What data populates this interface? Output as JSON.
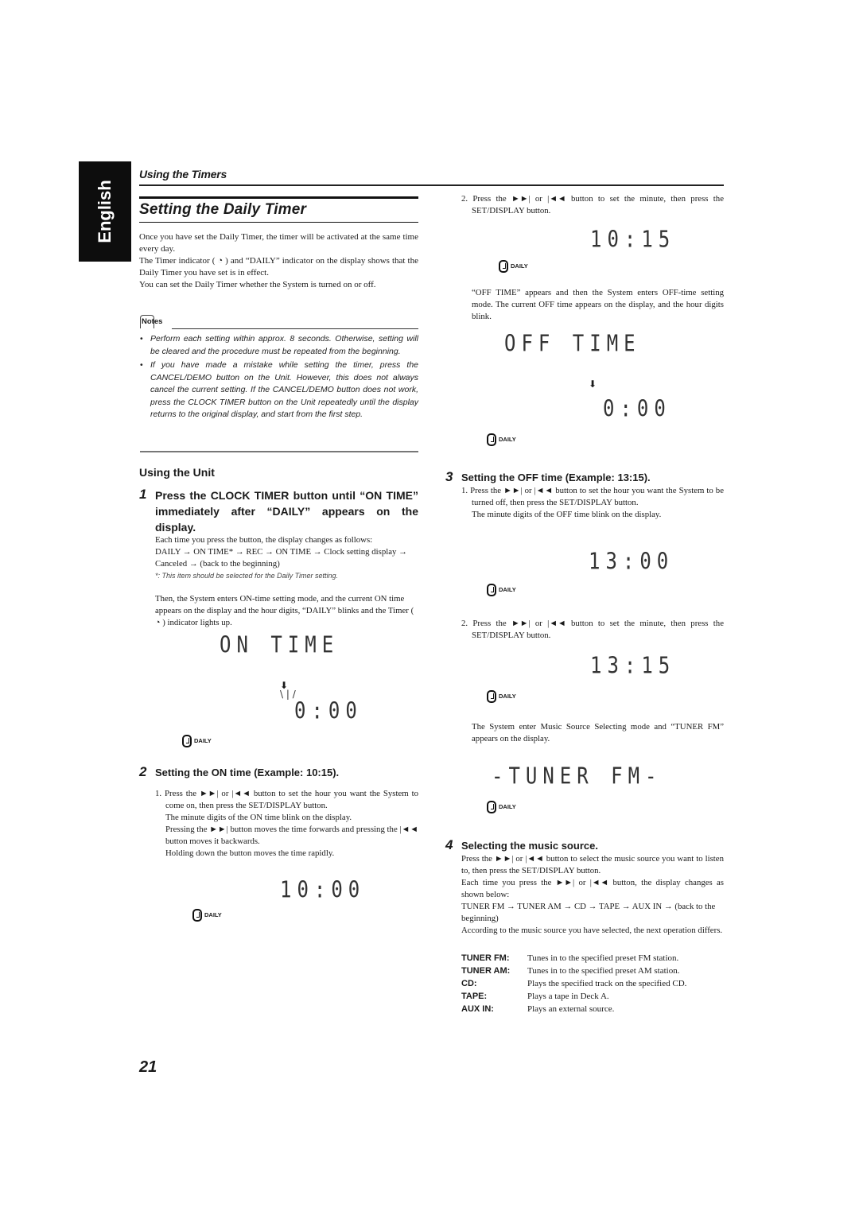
{
  "language_tab": "English",
  "section_header": "Using the Timers",
  "title": "Setting the Daily Timer",
  "intro": [
    "Once you have set the Daily Timer, the timer will be activated at the same time every day.",
    "The Timer indicator ( ◔ ) and “DAILY” indicator on the display shows that the Daily Timer you have set is in effect.",
    "You can set the Daily Timer whether the System is turned on or off."
  ],
  "notes": {
    "label": "Notes",
    "items": [
      "Perform each setting within approx. 8 seconds. Otherwise, setting will be cleared and the procedure must be repeated from the beginning.",
      "If you have made a mistake while setting the timer, press the CANCEL/DEMO button on the Unit. However, this does not always cancel the current setting. If the CANCEL/DEMO button does not work, press the CLOCK TIMER button on the Unit repeatedly until the display returns to the original display, and start from the first step."
    ]
  },
  "using_unit": "Using the Unit",
  "step1": {
    "num": "1",
    "heading": "Press the CLOCK TIMER button until “ON TIME” immediately after “DAILY” appears on the display.",
    "body": "Each time you press the button, the display changes as follows:",
    "sequence": "DAILY → ON TIME* → REC → ON TIME → Clock setting display → Canceled → (back to the beginning)",
    "footnote": "*: This item should be selected for the Daily Timer setting.",
    "after": "Then, the System enters ON-time setting mode, and the current ON time appears on the display and the hour digits, “DAILY” blinks and the Timer ( ◔ ) indicator lights up.",
    "lcd_text": "ON  TIME",
    "lcd_time": "0:00"
  },
  "step2": {
    "num": "2",
    "heading": "Setting the ON time (Example: 10:15).",
    "item1": "1. Press the ►►| or |◄◄ button to set the hour you want the System to come on, then press the SET/DISPLAY button.",
    "item1b": "The minute digits of the ON time blink on the display.",
    "item1c": "Pressing the ►►| button moves the time forwards and pressing the |◄◄ button moves it backwards.",
    "item1d": "Holding down the button moves the time rapidly.",
    "lcd_time1": "10:00",
    "item2": "2. Press the ►►| or |◄◄ button to set the minute, then press the SET/DISPLAY button.",
    "lcd_time2": "10:15",
    "after": "“OFF TIME” appears and then the System enters OFF-time setting mode. The current OFF time appears on the display, and the hour digits blink.",
    "lcd_text": "OFF  TIME",
    "lcd_time3": "0:00"
  },
  "step3": {
    "num": "3",
    "heading": "Setting the OFF time (Example: 13:15).",
    "item1": "1. Press the ►►| or |◄◄ button to set the hour you want the System to be turned off, then press the SET/DISPLAY button.",
    "item1b": "The minute digits of the OFF time blink on the display.",
    "lcd_time1": "13:00",
    "item2": "2. Press the ►►| or |◄◄ button to set the minute, then press the SET/DISPLAY button.",
    "lcd_time2": "13:15",
    "after": "The System enter Music Source Selecting mode and “TUNER FM” appears on the display.",
    "lcd_text": "-TUNER FM-"
  },
  "step4": {
    "num": "4",
    "heading": "Selecting the music source.",
    "body1": "Press the ►►| or |◄◄ button to select the music source you want to listen to, then press the SET/DISPLAY button.",
    "body2": "Each time you press the ►►| or |◄◄ button, the display changes as shown below:",
    "sequence": "TUNER FM → TUNER AM → CD → TAPE → AUX IN → (back to the beginning)",
    "body3": "According to the music source you have selected, the next operation differs.",
    "sources": [
      {
        "key": "TUNER FM:",
        "desc": "Tunes in to the specified preset FM station."
      },
      {
        "key": "TUNER AM:",
        "desc": "Tunes in to the specified preset AM station."
      },
      {
        "key": "CD:",
        "desc": "Plays the specified track on the specified CD."
      },
      {
        "key": "TAPE:",
        "desc": "Plays a tape in Deck A."
      },
      {
        "key": "AUX IN:",
        "desc": "Plays an external source."
      }
    ]
  },
  "daily_label": "DAILY",
  "page_number": "21"
}
